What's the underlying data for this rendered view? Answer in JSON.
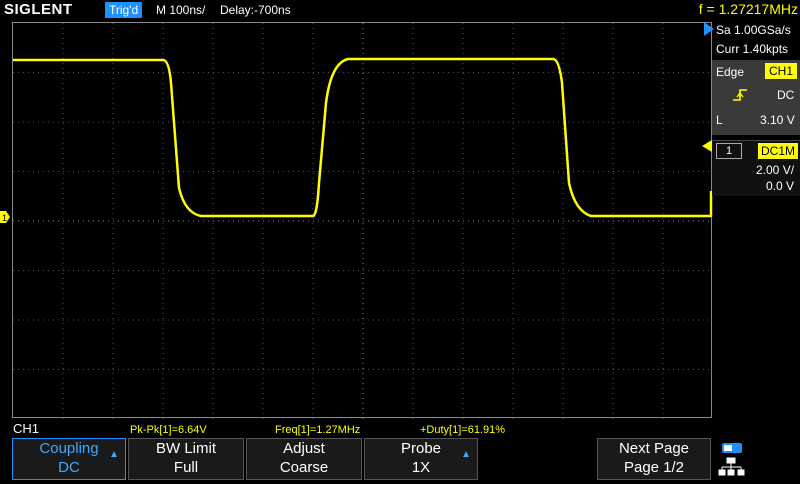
{
  "header": {
    "brand": "SIGLENT",
    "trigger_status": "Trig'd",
    "timebase": "M 100ns/",
    "delay": "Delay:-700ns",
    "frequency": "f = 1.27217MHz"
  },
  "right_panel": {
    "sample_rate": "Sa 1.00GSa/s",
    "memory": "Curr 1.40kpts",
    "trigger": {
      "type_label": "Edge",
      "source": "CH1",
      "slope_icon": "rising-edge-icon",
      "coupling": "DC",
      "level_label": "L",
      "level": "3.10 V"
    },
    "channel": {
      "number": "1",
      "coupling_impedance": "DC1M",
      "volts_per_div": "2.00 V/",
      "offset": "0.0 V"
    }
  },
  "measurements": {
    "channel_label": "CH1",
    "items": [
      "Pk-Pk[1]=6.64V",
      "Freq[1]=1.27MHz",
      "+Duty[1]=61.91%"
    ]
  },
  "softkeys": [
    {
      "line1": "Coupling",
      "line2": "DC"
    },
    {
      "line1": "BW Limit",
      "line2": "Full"
    },
    {
      "line1": "Adjust",
      "line2": "Coarse"
    },
    {
      "line1": "Probe",
      "line2": "1X"
    },
    {
      "line1": "Next Page",
      "line2": "Page 1/2"
    }
  ],
  "colors": {
    "trace": "#ffff00",
    "accent": "#1e90ff"
  }
}
